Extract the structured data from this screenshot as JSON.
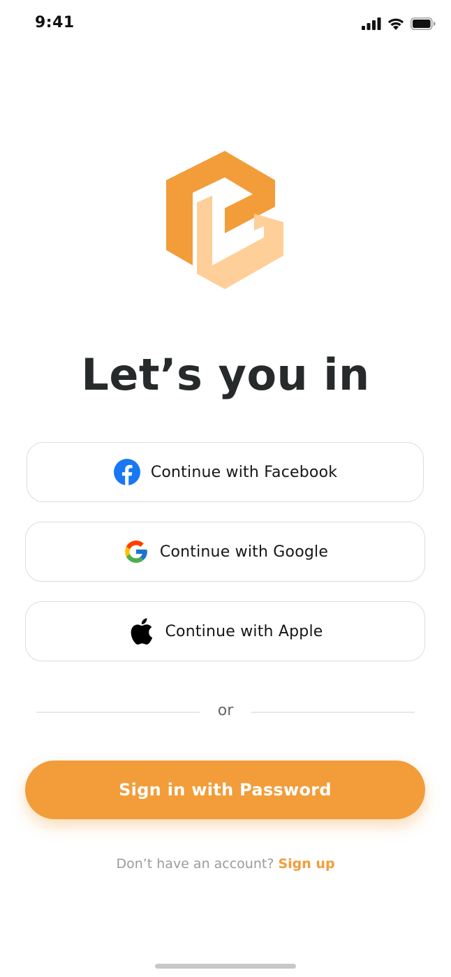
{
  "status_bar": {
    "time": "9:41",
    "icons": [
      "signal-icon",
      "wifi-icon",
      "battery-icon"
    ]
  },
  "logo": {
    "icon": "brand-logo-icon",
    "colors": {
      "primary": "#f29d3a",
      "secondary": "#fecf98"
    }
  },
  "title": "Let’s you in",
  "social_buttons": [
    {
      "id": "facebook",
      "label": "Continue with Facebook",
      "icon": "facebook-icon",
      "color": "#1877f2"
    },
    {
      "id": "google",
      "label": "Continue with Google",
      "icon": "google-icon"
    },
    {
      "id": "apple",
      "label": "Continue with Apple",
      "icon": "apple-icon",
      "color": "#000000"
    }
  ],
  "divider": {
    "text": "or"
  },
  "primary_button": {
    "label": "Sign in with Password",
    "color": "#f29d3a"
  },
  "signup": {
    "prompt": "Don’t have an account?",
    "link_label": "Sign up"
  }
}
